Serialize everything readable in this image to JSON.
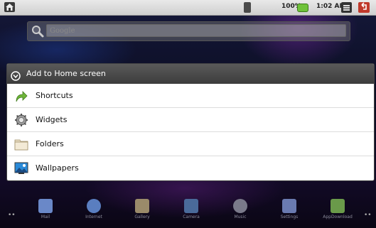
{
  "status_bar": {
    "battery": "100%",
    "time": "1:02 AM"
  },
  "search": {
    "placeholder": "Google"
  },
  "dialog": {
    "title": "Add to Home screen",
    "options": [
      {
        "label": "Shortcuts",
        "icon": "shortcut-arrow-icon"
      },
      {
        "label": "Widgets",
        "icon": "gear-widgets-icon"
      },
      {
        "label": "Folders",
        "icon": "folder-icon"
      },
      {
        "label": "Wallpapers",
        "icon": "wallpaper-icon"
      }
    ]
  },
  "dock": {
    "items": [
      {
        "label": "Mail",
        "color": "#6a88c8"
      },
      {
        "label": "Internet",
        "color": "#5a7ec0"
      },
      {
        "label": "Gallery",
        "color": "#9a8a6a"
      },
      {
        "label": "Camera",
        "color": "#4a6a9a"
      },
      {
        "label": "Music",
        "color": "#7a7a8a"
      },
      {
        "label": "Settings",
        "color": "#6a7ab0"
      },
      {
        "label": "AppDownload",
        "color": "#6a9a4a"
      }
    ]
  },
  "colors": {
    "battery": "#6fc23a",
    "back_button": "#c0392b",
    "dialog_title_bg": "#3c3c3c"
  }
}
